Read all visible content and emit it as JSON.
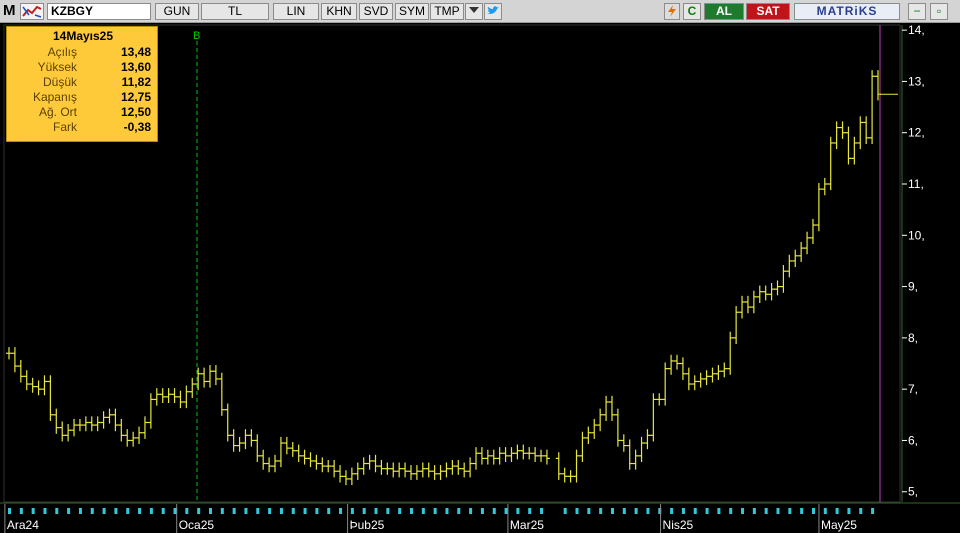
{
  "toolbar": {
    "logo": "M",
    "symbol": "KZBGY",
    "buttons": [
      "GUN",
      "TL",
      "LIN",
      "KHN",
      "SVD",
      "SYM",
      "TMP"
    ],
    "al_label": "AL",
    "sat_label": "SAT",
    "brand": "MATRiKS",
    "c_label": "C"
  },
  "infobox": {
    "date": "14Mayıs25",
    "rows": [
      {
        "label": "Açılış",
        "value": "13,48"
      },
      {
        "label": "Yüksek",
        "value": "13,60"
      },
      {
        "label": "Düşük",
        "value": "11,82"
      },
      {
        "label": "Kapanış",
        "value": "12,75"
      },
      {
        "label": "Ağ. Ort",
        "value": "12,50"
      },
      {
        "label": "Fark",
        "value": "-0,38"
      }
    ]
  },
  "chart_data": {
    "type": "ohlc",
    "marker_label": "B",
    "y_ticks": [
      "5,",
      "6,",
      "7,",
      "8,",
      "9,",
      "10,",
      "11,",
      "12,",
      "13,",
      "14,"
    ],
    "ylim": [
      4.8,
      14.1
    ],
    "x_labels": [
      "Ara24",
      "Oca25",
      "Þub25",
      "Mar25",
      "Nis25",
      "May25"
    ],
    "colors": {
      "bars": "#e8e83a",
      "grid": "#00a000",
      "marker": "#00c800",
      "cursor": "#c040c0",
      "axis_text": "#ffffff"
    },
    "closes": [
      7.7,
      7.45,
      7.25,
      7.1,
      7.05,
      7.0,
      7.15,
      6.5,
      6.25,
      6.1,
      6.2,
      6.3,
      6.3,
      6.35,
      6.3,
      6.35,
      6.45,
      6.5,
      6.3,
      6.1,
      6.0,
      6.05,
      6.15,
      6.35,
      6.8,
      6.9,
      6.85,
      6.9,
      6.85,
      6.75,
      6.95,
      7.1,
      7.3,
      7.15,
      7.35,
      7.2,
      6.6,
      6.1,
      5.9,
      5.95,
      6.1,
      6.0,
      5.7,
      5.55,
      5.5,
      5.6,
      5.95,
      5.85,
      5.8,
      5.7,
      5.65,
      5.6,
      5.55,
      5.5,
      5.5,
      5.4,
      5.3,
      5.25,
      5.35,
      5.45,
      5.55,
      5.6,
      5.5,
      5.45,
      5.45,
      5.4,
      5.45,
      5.4,
      5.35,
      5.4,
      5.45,
      5.4,
      5.35,
      5.4,
      5.45,
      5.5,
      5.45,
      5.4,
      5.55,
      5.75,
      5.65,
      5.7,
      5.65,
      5.75,
      5.7,
      5.75,
      5.8,
      5.75,
      5.75,
      5.7,
      5.7,
      5.65,
      null,
      5.35,
      5.3,
      5.3,
      5.7,
      6.05,
      6.15,
      6.3,
      6.5,
      6.75,
      6.5,
      6.0,
      5.9,
      5.55,
      5.7,
      5.95,
      6.1,
      6.8,
      6.8,
      7.4,
      7.55,
      7.5,
      7.3,
      7.1,
      7.15,
      7.2,
      7.25,
      7.3,
      7.35,
      7.4,
      8.0,
      8.5,
      8.7,
      8.6,
      8.8,
      8.9,
      8.85,
      8.95,
      9.0,
      9.3,
      9.5,
      9.6,
      9.75,
      9.95,
      10.2,
      10.9,
      11.0,
      11.8,
      12.1,
      12.0,
      11.5,
      11.8,
      12.2,
      11.9,
      13.1,
      12.75
    ]
  }
}
